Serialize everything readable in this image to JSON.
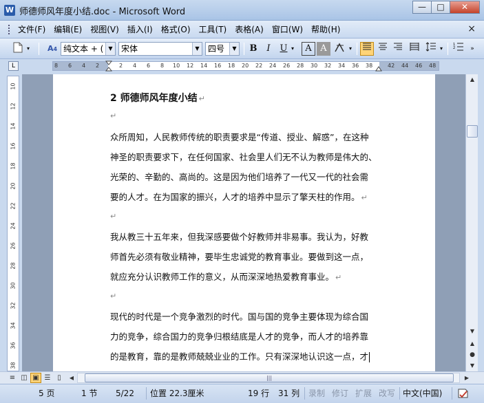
{
  "window": {
    "title": "师德师风年度小结.doc - Microsoft Word",
    "app_icon": "W",
    "minimize": "—",
    "maximize": "□",
    "close": "✕"
  },
  "menubar": {
    "items": [
      "文件(F)",
      "编辑(E)",
      "视图(V)",
      "插入(I)",
      "格式(O)",
      "工具(T)",
      "表格(A)",
      "窗口(W)",
      "帮助(H)"
    ],
    "close": "×"
  },
  "toolbar": {
    "style_value": "纯文本 + (",
    "font_value": "宋体",
    "size_value": "四号",
    "bold": "B",
    "italic": "I",
    "underline": "U",
    "char_border": "A",
    "char_shading": "A"
  },
  "ruler": {
    "corner": "L",
    "h_marks": [
      "8",
      "6",
      "4",
      "2",
      "2",
      "4",
      "6",
      "8",
      "10",
      "12",
      "14",
      "16",
      "18",
      "20",
      "22",
      "24",
      "26",
      "28",
      "30",
      "32",
      "34",
      "36",
      "38",
      "42",
      "44",
      "46",
      "48"
    ],
    "v_marks": [
      "10",
      "12",
      "14",
      "16",
      "18",
      "20",
      "22",
      "24",
      "26",
      "28",
      "30",
      "32",
      "34",
      "36",
      "38"
    ]
  },
  "document": {
    "title": "2 师德师风年度小结",
    "para_mark": "↵",
    "paragraphs": [
      {
        "lines": [
          "众所周知，人民教师传统的职责要求是“传道、授业、解惑”，在这种",
          "神圣的职责要求下，在任何国家、社会里人们无不认为教师是伟大的、",
          "光荣的、辛勤的、高尚的。这是因为他们培养了一代又一代的社会需",
          "要的人才。在为国家的振兴，人才的培养中显示了擎天柱的作用。"
        ]
      },
      {
        "lines": [
          "我从教三十五年来，但我深感要做个好教师并非易事。我认为，好教",
          "师首先必须有敬业精神，要毕生忠诚党的教育事业。要做到这一点，",
          "就应充分认识教师工作的意义，从而深深地热爱教育事业。"
        ]
      },
      {
        "lines": [
          "现代的时代是一个竞争激烈的时代。国与国的竞争主要体现为综合国",
          "力的竞争，综合国力的竞争归根结底是人才的竞争，而人才的培养靠",
          "的是教育，靠的是教师兢兢业业的工作。只有深深地认识这一点，才"
        ]
      }
    ]
  },
  "statusbar": {
    "page": "5 页",
    "section": "1 节",
    "page_of": "5/22",
    "position": "位置 22.3厘米",
    "line": "19 行",
    "column": "31 列",
    "rec": "录制",
    "trk": "修订",
    "ext": "扩展",
    "ovr": "改写",
    "language": "中文(中国)"
  }
}
